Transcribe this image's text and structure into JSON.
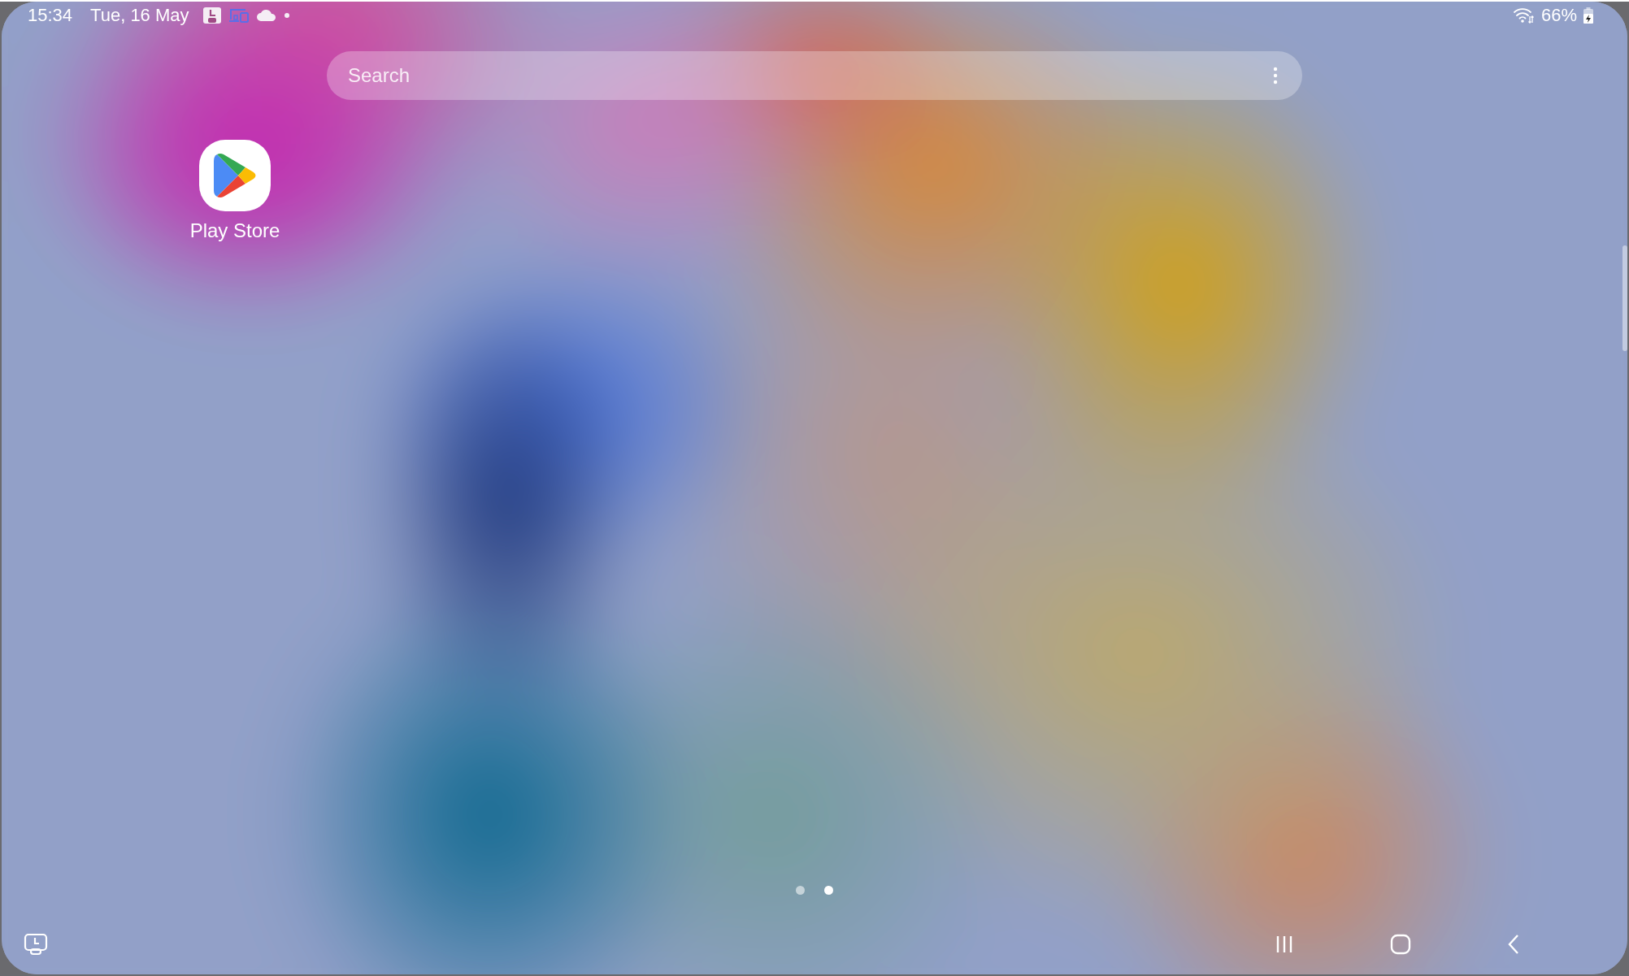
{
  "status_bar": {
    "time": "15:34",
    "date": "Tue, 16 May",
    "battery": "66%"
  },
  "search": {
    "placeholder": "Search"
  },
  "apps": [
    {
      "label": "Play Store"
    }
  ],
  "page_indicator": [
    {
      "selected": false
    },
    {
      "selected": true
    }
  ]
}
